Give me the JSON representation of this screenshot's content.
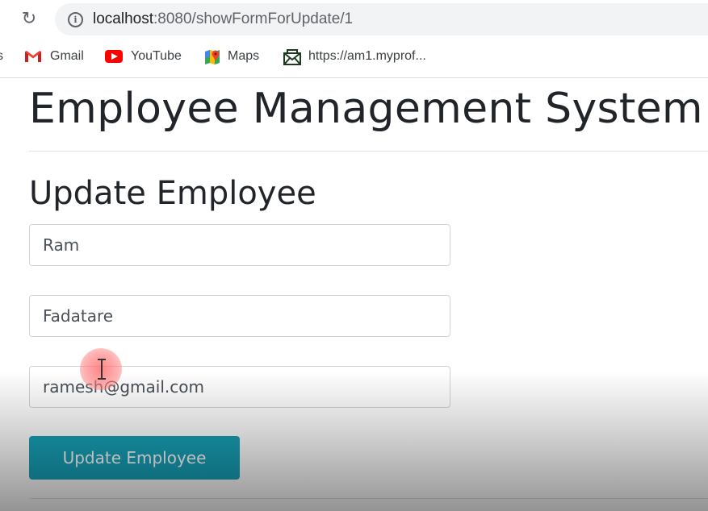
{
  "browser": {
    "url_host": "localhost",
    "url_path": ":8080/showFormForUpdate/1",
    "bookmarks": [
      {
        "label": "s"
      },
      {
        "label": "Gmail",
        "icon": "gmail-icon"
      },
      {
        "label": "YouTube",
        "icon": "youtube-icon"
      },
      {
        "label": "Maps",
        "icon": "maps-icon"
      },
      {
        "label": "https://am1.myprof...",
        "icon": "mail-envelope-icon"
      }
    ]
  },
  "page": {
    "title": "Employee Management System",
    "form_title": "Update Employee",
    "fields": {
      "first_name": "Ram",
      "last_name": "Fadatare",
      "email": "ramesh@gmail.com"
    },
    "submit_label": "Update Employee"
  },
  "colors": {
    "button": "#17a2b8",
    "text": "#212529"
  }
}
